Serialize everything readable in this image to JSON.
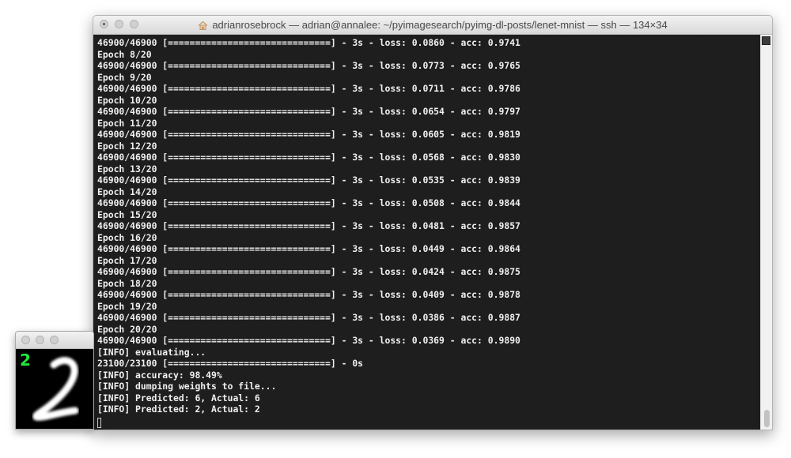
{
  "window": {
    "title": "adrianrosebrock — adrian@annalee: ~/pyimagesearch/pyimg-dl-posts/lenet-mnist — ssh — 134×34"
  },
  "terminal": {
    "lines": [
      "46900/46900 [==============================] - 3s - loss: 0.0860 - acc: 0.9741",
      "Epoch 8/20",
      "46900/46900 [==============================] - 3s - loss: 0.0773 - acc: 0.9765",
      "Epoch 9/20",
      "46900/46900 [==============================] - 3s - loss: 0.0711 - acc: 0.9786",
      "Epoch 10/20",
      "46900/46900 [==============================] - 3s - loss: 0.0654 - acc: 0.9797",
      "Epoch 11/20",
      "46900/46900 [==============================] - 3s - loss: 0.0605 - acc: 0.9819",
      "Epoch 12/20",
      "46900/46900 [==============================] - 3s - loss: 0.0568 - acc: 0.9830",
      "Epoch 13/20",
      "46900/46900 [==============================] - 3s - loss: 0.0535 - acc: 0.9839",
      "Epoch 14/20",
      "46900/46900 [==============================] - 3s - loss: 0.0508 - acc: 0.9844",
      "Epoch 15/20",
      "46900/46900 [==============================] - 3s - loss: 0.0481 - acc: 0.9857",
      "Epoch 16/20",
      "46900/46900 [==============================] - 3s - loss: 0.0449 - acc: 0.9864",
      "Epoch 17/20",
      "46900/46900 [==============================] - 3s - loss: 0.0424 - acc: 0.9875",
      "Epoch 18/20",
      "46900/46900 [==============================] - 3s - loss: 0.0409 - acc: 0.9878",
      "Epoch 19/20",
      "46900/46900 [==============================] - 3s - loss: 0.0386 - acc: 0.9887",
      "Epoch 20/20",
      "46900/46900 [==============================] - 3s - loss: 0.0369 - acc: 0.9890",
      "[INFO] evaluating...",
      "23100/23100 [==============================] - 0s",
      "[INFO] accuracy: 98.49%",
      "[INFO] dumping weights to file...",
      "[INFO] Predicted: 6, Actual: 6",
      "[INFO] Predicted: 2, Actual: 2"
    ],
    "text_color": "#f0f0f0",
    "background": "#1e1e1e"
  },
  "image_window": {
    "predicted_label": "2",
    "label_color": "#1fe83b"
  }
}
